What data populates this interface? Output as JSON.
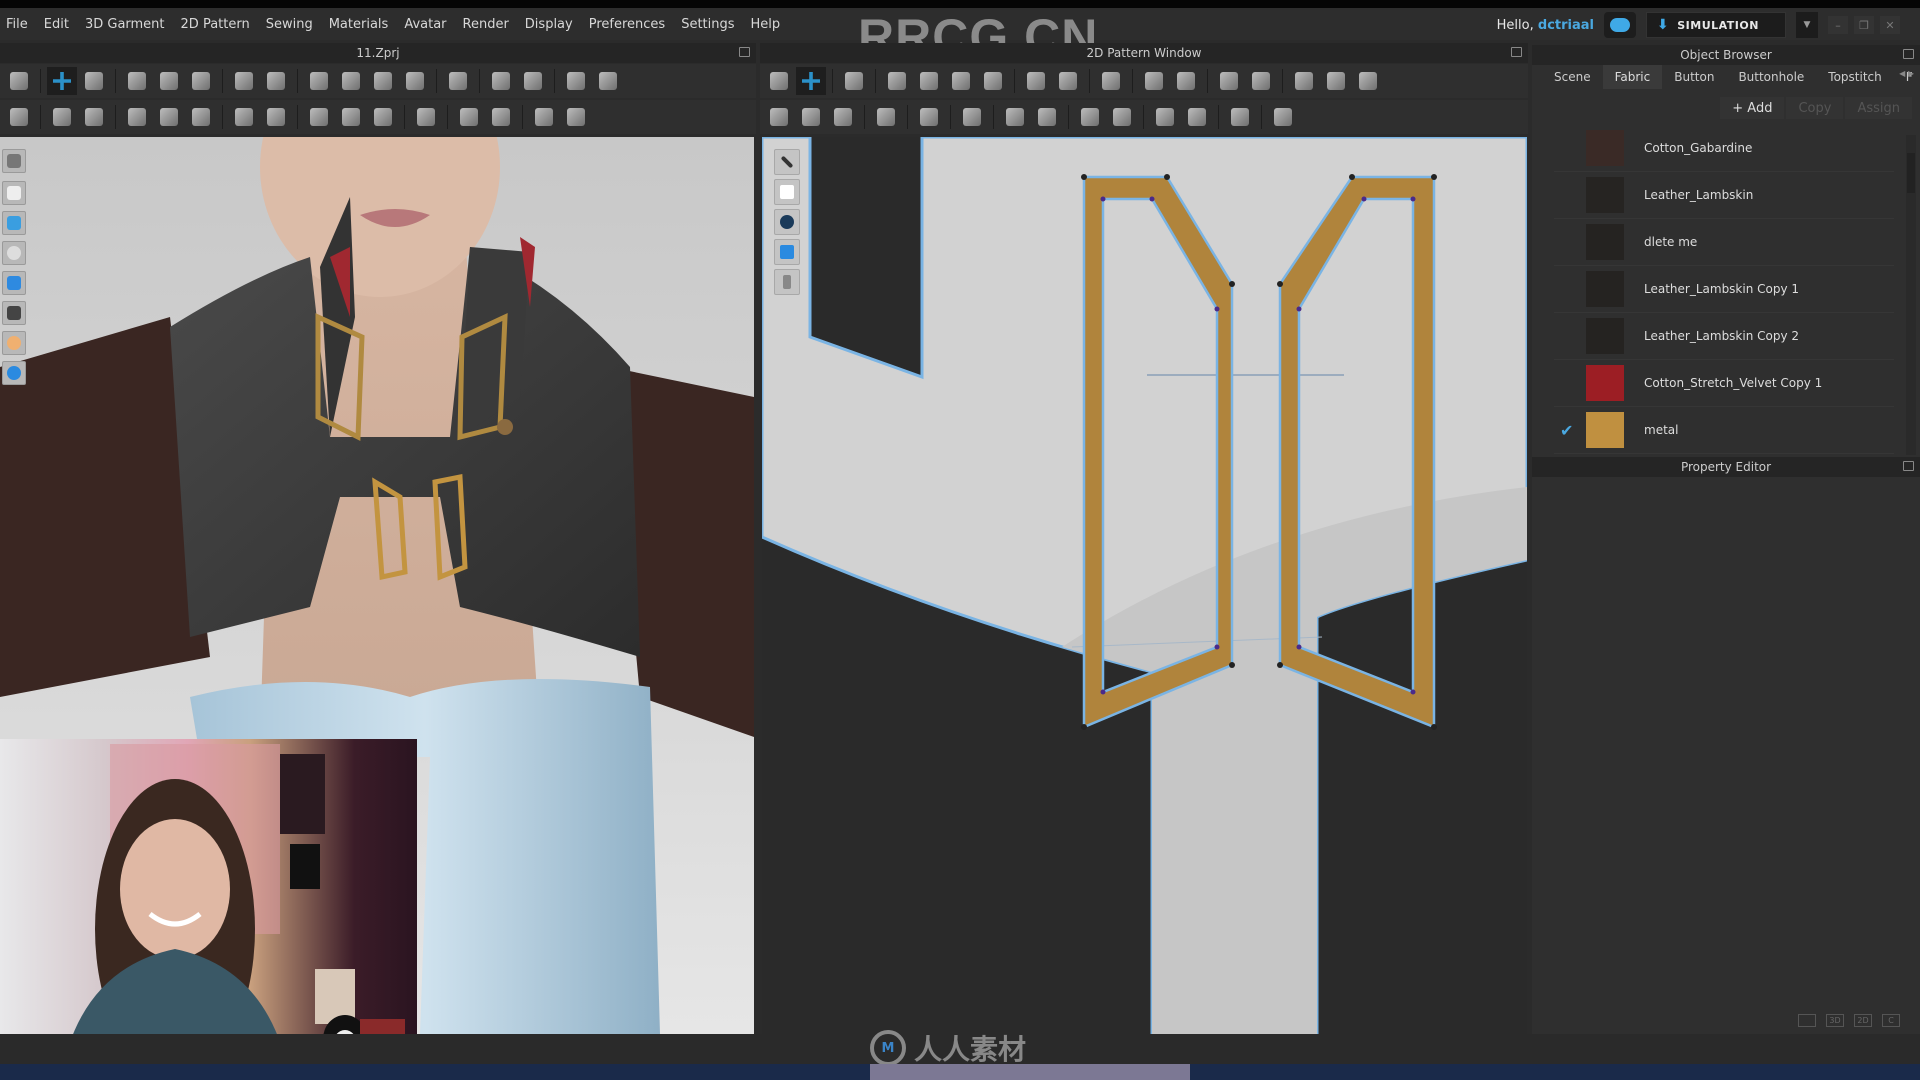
{
  "app": {
    "project_file": "11.Zprj",
    "watermark": "RRCG.CN",
    "bottom_watermark": "人人素材"
  },
  "menu": [
    "File",
    "Edit",
    "3D Garment",
    "2D Pattern",
    "Sewing",
    "Materials",
    "Avatar",
    "Render",
    "Display",
    "Preferences",
    "Settings",
    "Help"
  ],
  "user": {
    "greeting": "Hello,",
    "username": "dctriaal",
    "mode_label": "SIMULATION"
  },
  "panes": {
    "pattern_window_title": "2D Pattern Window",
    "object_browser_title": "Object Browser",
    "property_editor_title": "Property Editor"
  },
  "object_browser": {
    "tabs": [
      "Scene",
      "Fabric",
      "Button",
      "Buttonhole",
      "Topstitch",
      "F"
    ],
    "active_tab": "Fabric",
    "actions": {
      "add": "+ Add",
      "copy": "Copy",
      "assign": "Assign"
    },
    "fabrics": [
      {
        "name": "Cotton_Gabardine",
        "color": "#3a2a26",
        "selected": false
      },
      {
        "name": "Leather_Lambskin",
        "color": "#262422",
        "selected": false
      },
      {
        "name": "dlete me",
        "color": "#252321",
        "selected": false
      },
      {
        "name": "Leather_Lambskin Copy 1",
        "color": "#252321",
        "selected": false
      },
      {
        "name": "Leather_Lambskin Copy 2",
        "color": "#252321",
        "selected": false
      },
      {
        "name": "Cotton_Stretch_Velvet Copy 1",
        "color": "#9c1e24",
        "selected": false
      },
      {
        "name": "metal",
        "color": "#c09040",
        "selected": true
      }
    ]
  },
  "view_switch": [
    "",
    "3D",
    "2D",
    "C"
  ],
  "colors": {
    "accent": "#3fa9e6",
    "metal_fabric": "#b0843c",
    "pattern_bg": "#d2d2d2",
    "pattern_outline": "#7ab4e4"
  }
}
